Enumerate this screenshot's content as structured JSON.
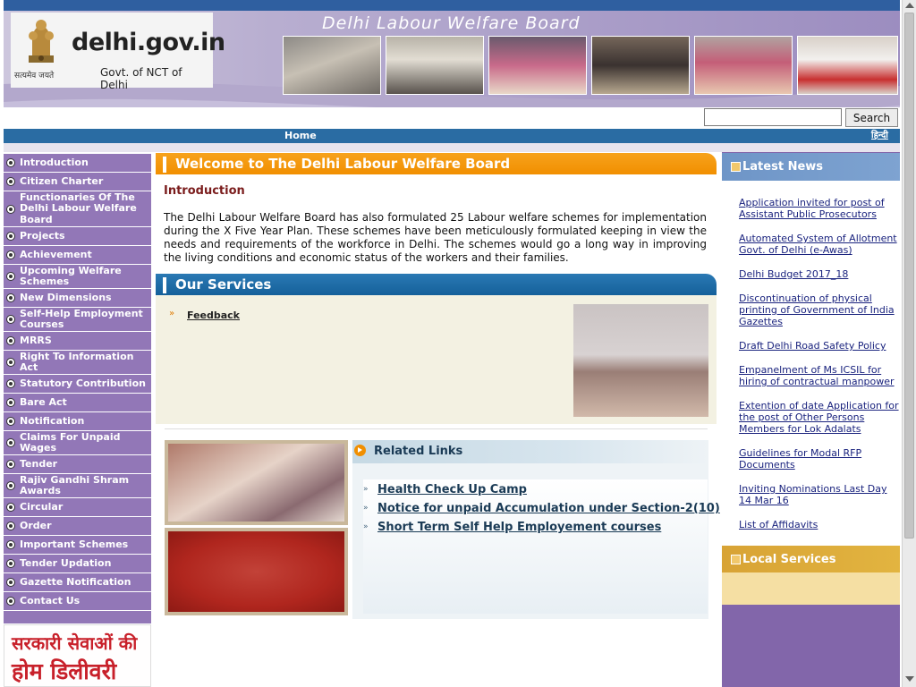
{
  "header": {
    "logo_text": "delhi.gov.in",
    "logo_tagline": "सत्यमेव जयते",
    "logo_subtitle": "Govt. of NCT of Delhi",
    "site_title": "Delhi Labour Welfare Board",
    "icons": [
      "emblem-icon"
    ]
  },
  "search": {
    "value": "",
    "placeholder": "",
    "button_label": "Search"
  },
  "nav": {
    "home_label": "Home",
    "hindi_label": "हिन्दी"
  },
  "sidebar": {
    "items": [
      {
        "label": "Introduction"
      },
      {
        "label": "Citizen Charter"
      },
      {
        "label": "Functionaries Of The Delhi Labour Welfare Board"
      },
      {
        "label": "Projects"
      },
      {
        "label": "Achievement"
      },
      {
        "label": "Upcoming Welfare Schemes"
      },
      {
        "label": "New Dimensions"
      },
      {
        "label": "Self-Help Employment Courses"
      },
      {
        "label": "MRRS"
      },
      {
        "label": "Right To Information Act"
      },
      {
        "label": "Statutory Contribution"
      },
      {
        "label": "Bare Act"
      },
      {
        "label": "Notification"
      },
      {
        "label": "Claims For Unpaid Wages"
      },
      {
        "label": "Tender"
      },
      {
        "label": "Rajiv Gandhi Shram Awards"
      },
      {
        "label": "Circular"
      },
      {
        "label": "Order"
      },
      {
        "label": "Important Schemes"
      },
      {
        "label": "Tender Updation"
      },
      {
        "label": "Gazette Notification"
      },
      {
        "label": "Contact Us"
      }
    ],
    "banner_line1": "सरकारी सेवाओं की",
    "banner_line2": "होम डिलीवरी"
  },
  "main": {
    "welcome_title": "Welcome to The Delhi Labour Welfare Board",
    "intro_heading": "Introduction",
    "intro_body": "The Delhi Labour Welfare Board has also formulated 25 Labour welfare schemes for implementation during the X Five Year Plan. These schemes have been meticulously formulated keeping in view the needs and requirements of the workforce in Delhi. The schemes would go a long way in improving the living conditions and economic status of the workers and their families.",
    "services_title": "Our Services",
    "services_links": [
      {
        "label": "Feedback"
      }
    ],
    "related_title": "Related Links",
    "related_links": [
      {
        "label": "Health Check Up Camp"
      },
      {
        "label": "Notice for unpaid Accumulation under Section-2(10)"
      },
      {
        "label": "Short Term Self Help Employement courses"
      }
    ]
  },
  "right": {
    "news_title": "Latest News",
    "news": [
      {
        "label": "Application invited for post of Assistant Public Prosecutors"
      },
      {
        "label": "Automated System of Allotment Govt. of Delhi (e-Awas)"
      },
      {
        "label": "Delhi Budget 2017_18"
      },
      {
        "label": "Discontinuation of physical printing of Government of India Gazettes"
      },
      {
        "label": "Draft Delhi Road Safety Policy"
      },
      {
        "label": "Empanelment of Ms ICSIL for hiring of contractual manpower"
      },
      {
        "label": "Extention of date Application for the post of Other Persons Members for Lok Adalats"
      },
      {
        "label": "Guidelines for Modal RFP Documents"
      },
      {
        "label": "Inviting Nominations Last Day 14 Mar 16"
      },
      {
        "label": "List of Affidavits"
      }
    ],
    "local_title": "Local Services"
  },
  "colors": {
    "sidebar_purple": "#9277b7",
    "welcome_orange": "#f18f00",
    "services_blue": "#15609a",
    "news_blue": "#6e95c7",
    "local_gold": "#d8a335",
    "intro_heading_red": "#7a1c1c"
  }
}
